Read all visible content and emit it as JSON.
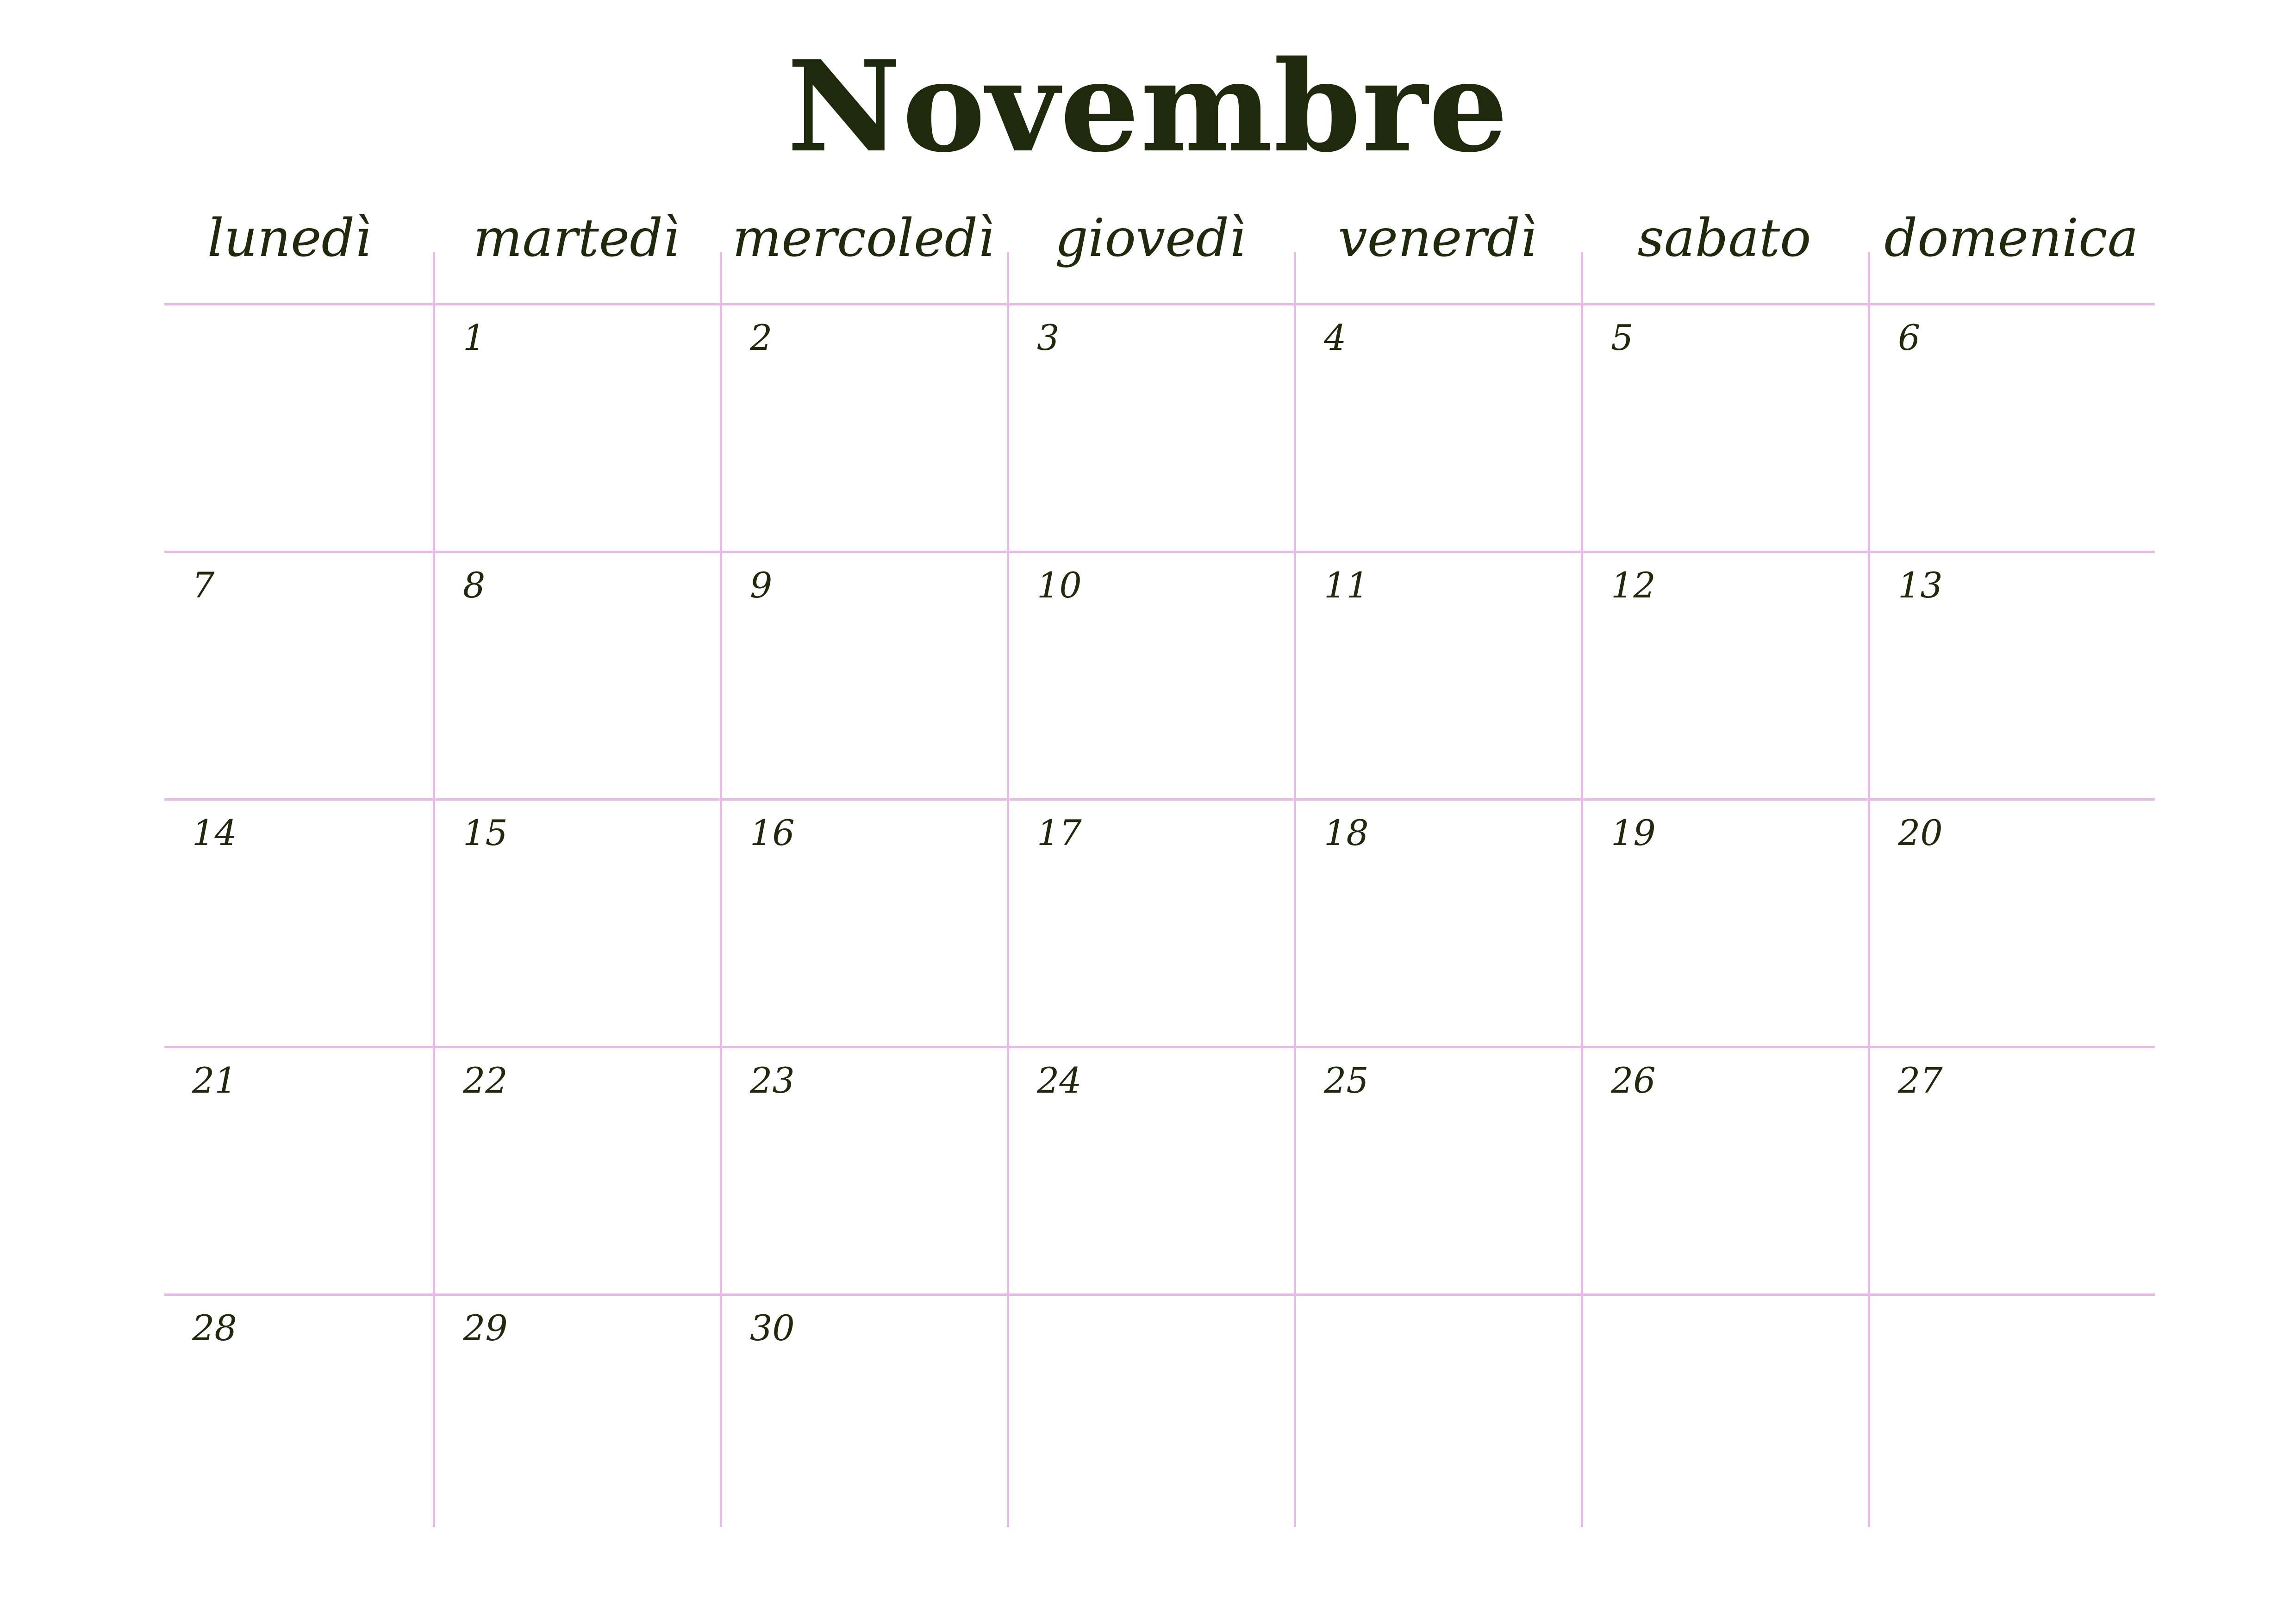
{
  "calendar": {
    "month": "Novembre",
    "weekdays": [
      "lunedì",
      "martedì",
      "mercoledì",
      "giovedì",
      "venerdì",
      "sabato",
      "domenica"
    ],
    "weeks": [
      [
        "",
        "1",
        "2",
        "3",
        "4",
        "5",
        "6"
      ],
      [
        "7",
        "8",
        "9",
        "10",
        "11",
        "12",
        "13"
      ],
      [
        "14",
        "15",
        "16",
        "17",
        "18",
        "19",
        "20"
      ],
      [
        "21",
        "22",
        "23",
        "24",
        "25",
        "26",
        "27"
      ],
      [
        "28",
        "29",
        "30",
        "",
        "",
        "",
        ""
      ]
    ]
  },
  "colors": {
    "text": "#1f2a0c",
    "grid": "#e8b9e6",
    "background": "#ffffff"
  }
}
